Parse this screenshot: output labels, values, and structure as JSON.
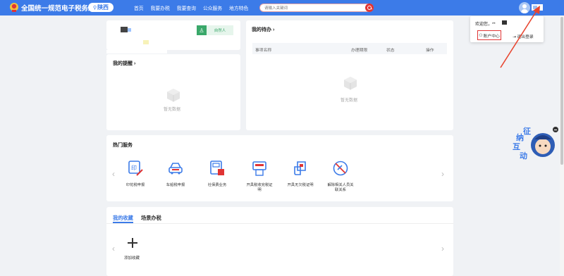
{
  "header": {
    "site_title": "全国统一规范电子税务局",
    "region": "陕西",
    "nav": [
      "首页",
      "我要办税",
      "我要查询",
      "公众服务",
      "地方特色"
    ],
    "search_placeholder": "请输入关键词"
  },
  "profile": {
    "tag_label": "自然人"
  },
  "reminders": {
    "title": "我的提醒",
    "title_arrow": "›",
    "empty": "暂无数据"
  },
  "todo": {
    "title": "我的待办",
    "title_arrow": "›",
    "columns": [
      "事项名称",
      "办理期限",
      "状态",
      "操作"
    ],
    "empty": "暂无数据"
  },
  "hot_services": {
    "title": "热门服务",
    "items": [
      {
        "label_1": "印花税申报",
        "label_2": "",
        "icon": "stamp-icon"
      },
      {
        "label_1": "车船税申报",
        "label_2": "",
        "icon": "car-icon"
      },
      {
        "label_1": "社保费业务",
        "label_2": "",
        "icon": "social-security-icon"
      },
      {
        "label_1": "开具税收完税证",
        "label_2": "明",
        "icon": "tax-certificate-icon"
      },
      {
        "label_1": "开具无欠税证明",
        "label_2": "",
        "icon": "no-arrears-certificate-icon"
      },
      {
        "label_1": "解除相关人员关",
        "label_2": "联关系",
        "icon": "unlink-icon"
      }
    ],
    "prev_arrow": "‹",
    "next_arrow": "›"
  },
  "favorites": {
    "tabs": [
      "我的收藏",
      "场景办税"
    ],
    "add_label": "添加收藏",
    "prev_arrow": "‹",
    "next_arrow": "›"
  },
  "user_menu": {
    "welcome": "欢迎您，**",
    "account_center": "账户中心",
    "logout": "退出登录"
  },
  "mascot": {
    "chars": [
      "征",
      "纳",
      "互",
      "动"
    ]
  },
  "colors": {
    "header_blue": "#3c7be8",
    "accent_red": "#e03434",
    "green": "#3aa86a"
  }
}
